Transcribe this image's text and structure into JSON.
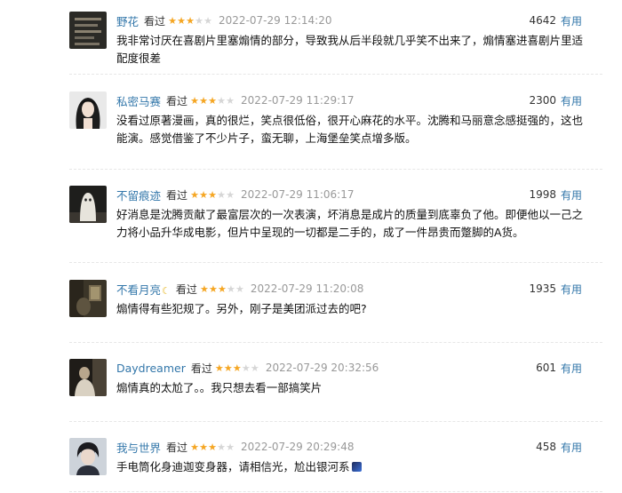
{
  "comments": [
    {
      "user": "野花",
      "status": "看过",
      "rating": 3,
      "time": "2022-07-29 12:14:20",
      "votes": "4642",
      "useful_label": "有用",
      "text": "我非常讨厌在喜剧片里塞煽情的部分，导致我从后半段就几乎笑不出来了，煽情塞进喜剧片里适配度很差",
      "avatar": "dark-text-image"
    },
    {
      "user": "私密马赛",
      "status": "看过",
      "rating": 3,
      "time": "2022-07-29 11:29:17",
      "votes": "2300",
      "useful_label": "有用",
      "text": "没看过原著漫画，真的很烂，笑点很低俗，很开心麻花的水平。沈腾和马丽意念感挺强的，这也能演。感觉借鉴了不少片子，蛮无聊，上海堡垒笑点增多版。",
      "avatar": "girl-black-hair-portrait"
    },
    {
      "user": "不留痕迹",
      "status": "看过",
      "rating": 3,
      "time": "2022-07-29 11:06:17",
      "votes": "1998",
      "useful_label": "有用",
      "text": "好消息是沈腾贡献了最富层次的一次表演，坏消息是成片的质量到底辜负了他。即便他以一己之力将小品升华成电影，但片中呈现的一切都是二手的，成了一件昂贵而蹩脚的A货。",
      "avatar": "ghost-sheet-figure"
    },
    {
      "user": "不看月亮",
      "user_suffix_icon": "moon-icon",
      "status": "看过",
      "rating": 3,
      "time": "2022-07-29 11:20:08",
      "votes": "1935",
      "useful_label": "有用",
      "text": "煽情得有些犯规了。另外，刚子是美团派过去的吧?",
      "avatar": "dim-room-photo"
    },
    {
      "user": "Daydreamer",
      "status": "看过",
      "rating": 3,
      "time": "2022-07-29 20:32:56",
      "votes": "601",
      "useful_label": "有用",
      "text": "煽情真的太尬了。。我只想去看一部搞笑片",
      "avatar": "dark-figure-photo"
    },
    {
      "user": "我与世界",
      "status": "看过",
      "rating": 3,
      "time": "2022-07-29 20:29:48",
      "votes": "458",
      "useful_label": "有用",
      "text": "手电筒化身迪迦变身器，请相信光，尬出银河系",
      "text_suffix_icon": "galaxy-emoji-icon",
      "avatar": "boy-portrait"
    }
  ]
}
